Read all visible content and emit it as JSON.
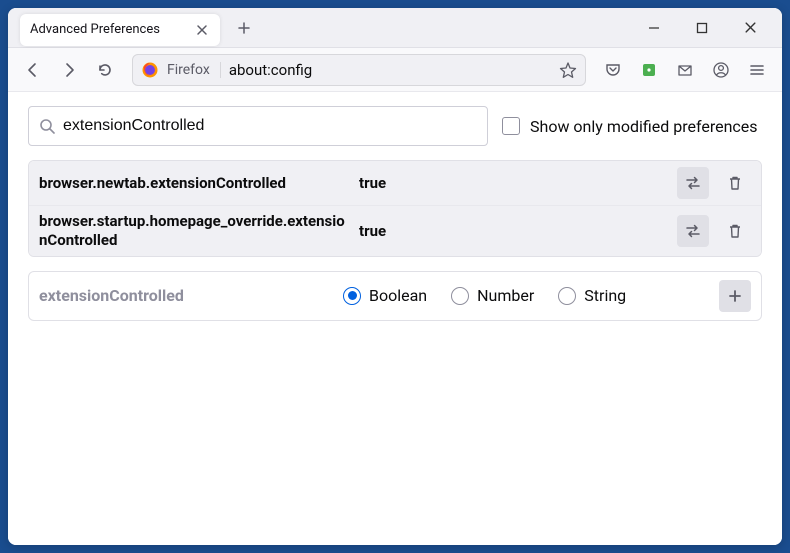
{
  "tab": {
    "title": "Advanced Preferences"
  },
  "urlbar": {
    "brand": "Firefox",
    "address": "about:config"
  },
  "search": {
    "value": "extensionControlled"
  },
  "show_modified_label": "Show only modified preferences",
  "prefs": [
    {
      "name": "browser.newtab.extensionControlled",
      "value": "true"
    },
    {
      "name": "browser.startup.homepage_override.extensionControlled",
      "value": "true"
    }
  ],
  "new_pref": {
    "name": "extensionControlled",
    "types": [
      "Boolean",
      "Number",
      "String"
    ],
    "selected": "Boolean"
  }
}
